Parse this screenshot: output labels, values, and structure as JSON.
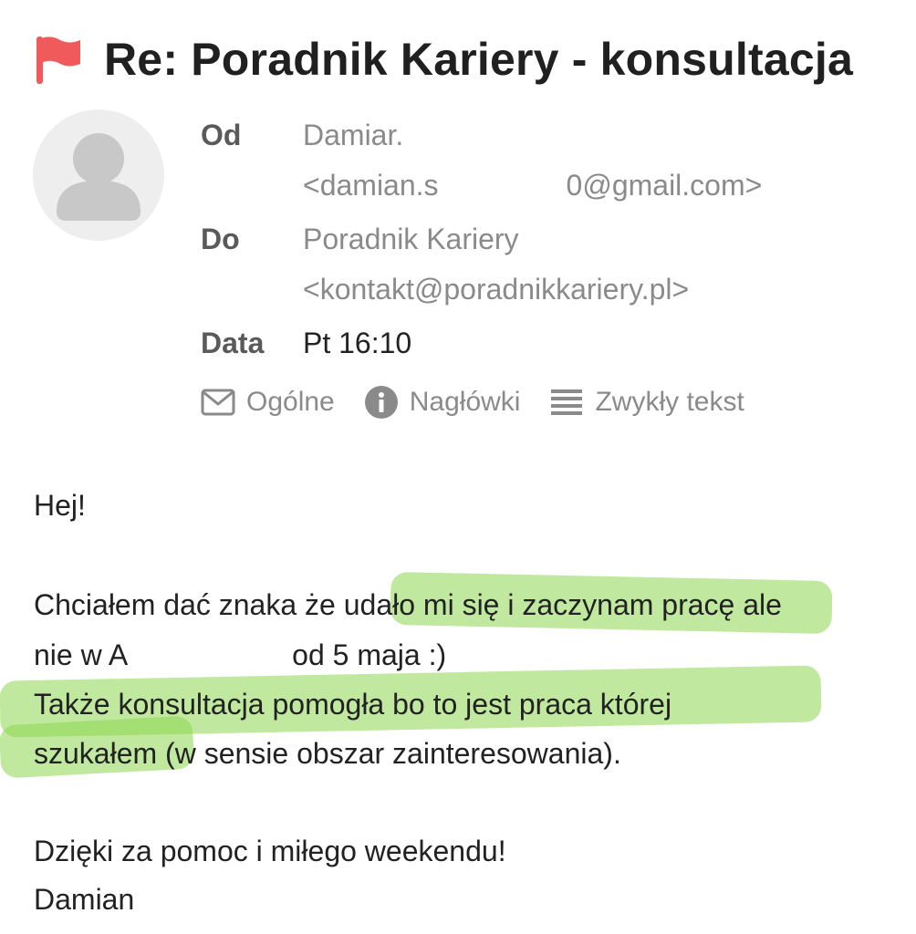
{
  "subject": {
    "flag_icon": "red-flag-icon",
    "flag_color": "#f05a5a",
    "title": "Re: Poradnik Kariery - konsultacja"
  },
  "header": {
    "avatar_icon": "default-user-avatar-icon",
    "from_label": "Od",
    "from_name": "Damiar. ",
    "from_email_start": "<damian.s",
    "from_email_end": "0@gmail.com>",
    "to_label": "Do",
    "to_name": "Poradnik Kariery",
    "to_email": "<kontakt@poradnikkariery.pl>",
    "date_label": "Data",
    "date_value": "Pt 16:10"
  },
  "view_tabs": {
    "general": "Ogólne",
    "general_icon": "envelope-icon",
    "headers": "Nagłówki",
    "headers_icon": "info-icon",
    "plain": "Zwykły tekst",
    "plain_icon": "lines-icon"
  },
  "message": {
    "greeting": "Hej!",
    "line1": "Chciałem dać znaka że udało mi się i zaczynam pracę ale",
    "line2_start": "nie w A",
    "line2_end": "od 5 maja :)",
    "line3": "Także konsultacja pomogła bo to jest praca której",
    "line4": "szukałem (w sensie obszar zainteresowania).",
    "line5": "Dzięki za pomoc i miłego weekendu!",
    "signature": "Damian",
    "highlight_color": "#8cd750"
  }
}
